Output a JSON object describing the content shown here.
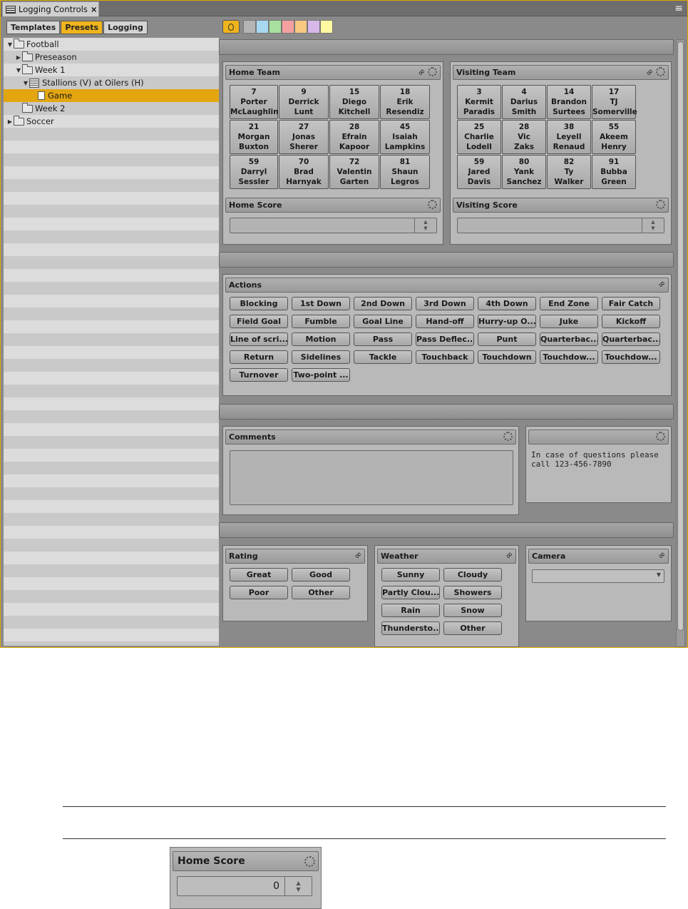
{
  "window": {
    "tab_title": "Logging Controls",
    "close_glyph": "×",
    "menu_glyph": "≡"
  },
  "modes": [
    "Templates",
    "Presets",
    "Logging"
  ],
  "active_mode": "Presets",
  "tree": [
    {
      "label": "Football",
      "depth": 0,
      "icon": "folder-icon",
      "expand": "down",
      "selected": false
    },
    {
      "label": "Preseason",
      "depth": 1,
      "icon": "folder-icon",
      "expand": "right",
      "selected": false
    },
    {
      "label": "Week 1",
      "depth": 1,
      "icon": "folder-icon",
      "expand": "down",
      "selected": false
    },
    {
      "label": "Stallions (V) at Oilers (H)",
      "depth": 2,
      "icon": "sequence-icon",
      "expand": "down",
      "selected": false
    },
    {
      "label": "Game",
      "depth": 3,
      "icon": "document-icon",
      "expand": "",
      "selected": true
    },
    {
      "label": "Week 2",
      "depth": 1,
      "icon": "folder-icon",
      "expand": "",
      "selected": false
    },
    {
      "label": "Soccer",
      "depth": 0,
      "icon": "folder-icon",
      "expand": "right",
      "selected": false
    }
  ],
  "swatches": [
    "#b4b4b4",
    "#a8d8f0",
    "#a8e0a0",
    "#f4a0a0",
    "#f8c880",
    "#d8b8e8",
    "#fff8a0"
  ],
  "home_team": {
    "title": "Home Team",
    "players": [
      {
        "num": "7",
        "first": "Porter",
        "last": "McLaughlin"
      },
      {
        "num": "9",
        "first": "Derrick",
        "last": "Lunt"
      },
      {
        "num": "15",
        "first": "Diego",
        "last": "Kitchell"
      },
      {
        "num": "18",
        "first": "Erik",
        "last": "Resendiz"
      },
      {
        "num": "21",
        "first": "Morgan",
        "last": "Buxton"
      },
      {
        "num": "27",
        "first": "Jonas",
        "last": "Sherer"
      },
      {
        "num": "28",
        "first": "Efrain",
        "last": "Kapoor"
      },
      {
        "num": "45",
        "first": "Isaiah",
        "last": "Lampkins"
      },
      {
        "num": "59",
        "first": "Darryl",
        "last": "Sessler"
      },
      {
        "num": "70",
        "first": "Brad",
        "last": "Harnyak"
      },
      {
        "num": "72",
        "first": "Valentin",
        "last": "Garten"
      },
      {
        "num": "81",
        "first": "Shaun",
        "last": "Legros"
      }
    ],
    "score_title": "Home Score",
    "score_value": ""
  },
  "visiting_team": {
    "title": "Visiting Team",
    "players": [
      {
        "num": "3",
        "first": "Kermit",
        "last": "Paradis"
      },
      {
        "num": "4",
        "first": "Darius",
        "last": "Smith"
      },
      {
        "num": "14",
        "first": "Brandon",
        "last": "Surtees"
      },
      {
        "num": "17",
        "first": "TJ",
        "last": "Somerville"
      },
      {
        "num": "25",
        "first": "Charlie",
        "last": "Lodell"
      },
      {
        "num": "28",
        "first": "Vic",
        "last": "Zaks"
      },
      {
        "num": "38",
        "first": "Leyell",
        "last": "Renaud"
      },
      {
        "num": "55",
        "first": "Akeem",
        "last": "Henry"
      },
      {
        "num": "59",
        "first": "Jared",
        "last": "Davis"
      },
      {
        "num": "80",
        "first": "Yank",
        "last": "Sanchez"
      },
      {
        "num": "82",
        "first": "Ty",
        "last": "Walker"
      },
      {
        "num": "91",
        "first": "Bubba",
        "last": "Green"
      }
    ],
    "score_title": "Visiting Score",
    "score_value": ""
  },
  "actions": {
    "title": "Actions",
    "items": [
      "Blocking",
      "1st Down",
      "2nd Down",
      "3rd Down",
      "4th Down",
      "End Zone",
      "Fair Catch",
      "Field Goal",
      "Fumble",
      "Goal Line",
      "Hand-off",
      "Hurry-up O...",
      "Juke",
      "Kickoff",
      "Line of scri...",
      "Motion",
      "Pass",
      "Pass Deflec...",
      "Punt",
      "Quarterbac...",
      "Quarterbac...",
      "Return",
      "Sidelines",
      "Tackle",
      "Touchback",
      "Touchdown",
      "Touchdow...",
      "Touchdow...",
      "Turnover",
      "Two-point ..."
    ]
  },
  "comments": {
    "title": "Comments",
    "value": ""
  },
  "notes": {
    "title": "",
    "text": "In case of questions please call 123-456-7890"
  },
  "rating": {
    "title": "Rating",
    "items": [
      "Great",
      "Good",
      "Poor",
      "Other"
    ]
  },
  "weather": {
    "title": "Weather",
    "items": [
      "Sunny",
      "Cloudy",
      "Partly Clou...",
      "Showers",
      "Rain",
      "Snow",
      "Thundersto...",
      "Other"
    ]
  },
  "camera": {
    "title": "Camera",
    "value": ""
  },
  "zoom_example": {
    "title": "Home Score",
    "value": "0"
  }
}
